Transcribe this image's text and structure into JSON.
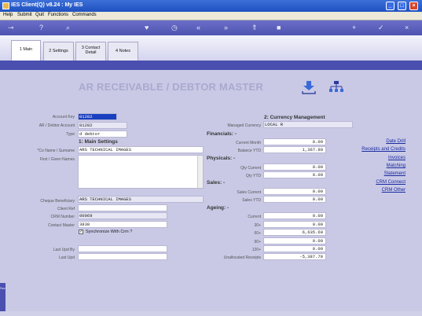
{
  "window": {
    "title": "IES Client(Q) v8.24 : My IES"
  },
  "menu": [
    "Help",
    "Submit",
    "Quit",
    "Functions",
    "Commands"
  ],
  "toolbar_icons": [
    "key-icon",
    "help-icon",
    "search-icon",
    "favorite-icon",
    "history-icon",
    "first-icon",
    "last-icon",
    "up-icon",
    "stop-icon",
    "add-icon",
    "confirm-icon",
    "close-icon"
  ],
  "tabs": [
    {
      "label": "1 Main",
      "active": true
    },
    {
      "label": "2 Settings"
    },
    {
      "label": "3 Contact\nDetail"
    },
    {
      "label": "4 Notes"
    }
  ],
  "form_title": "AR RECEIVABLE / DEBTOR MASTER",
  "labels": {
    "account_key": "Account Key",
    "debtor_account": "AR / Debtor Account",
    "type": "Type",
    "co_name": "*Co Name / Surname",
    "first_names": "First / Given Names",
    "cheque_beneficiary": "Cheque Beneficiary",
    "client_ref": "Client Ref",
    "crm_number": "CRM Number",
    "contact_master": "Contact Master",
    "last_upd_by": "Last Upd By",
    "last_upd": "Last Upd",
    "managed_currency": "Managed Currency",
    "current_month": "Current Month",
    "balance_ytd": "Balance YTD",
    "qty_current": "Qty Current",
    "qty_ytd": "Qty YTD",
    "sales_current": "Sales Current",
    "sales_ytd": "Sales YTD",
    "current": "Current",
    "d30": "30+",
    "d60": "60+",
    "d90": "90+",
    "d120": "120+",
    "unallocated": "Unallocated Receipts"
  },
  "values": {
    "account_key": "01282",
    "debtor_account": "01282",
    "type": "d debtor",
    "co_name": "ARS TECHNICAL IMAGES",
    "first_names": "",
    "cheque_beneficiary": "ARS TECHNICAL IMAGES",
    "client_ref": "",
    "crm_number": "00069",
    "contact_master": "3838",
    "sync_crm": "Synchronize With Crm ?",
    "last_upd_by": "",
    "last_upd": "",
    "managed_currency": "LOCAL R",
    "current_month": "0.00",
    "balance_ytd": "1,367.90",
    "qty_current": "0.00",
    "qty_ytd": "0.00",
    "sales_current": "0.00",
    "sales_ytd": "0.00",
    "current": "0.00",
    "d30": "0.00",
    "d60": "6,635.69",
    "d90": "0.00",
    "d120": "0.00",
    "unallocated": "-5,387.79"
  },
  "sections": {
    "main_settings": "1: Main Settings",
    "currency": "2: Currency Management",
    "financials": "Financials: -",
    "physicals": "Physicals: -",
    "sales": "Sales: -",
    "ageing": "Ageing: -"
  },
  "links": [
    "Date Drill",
    "Receipts and Credits",
    "Invoices",
    "Matching",
    "Statement",
    "CRM Connect",
    "CRM Other"
  ],
  "left_strip_label": "Svc"
}
